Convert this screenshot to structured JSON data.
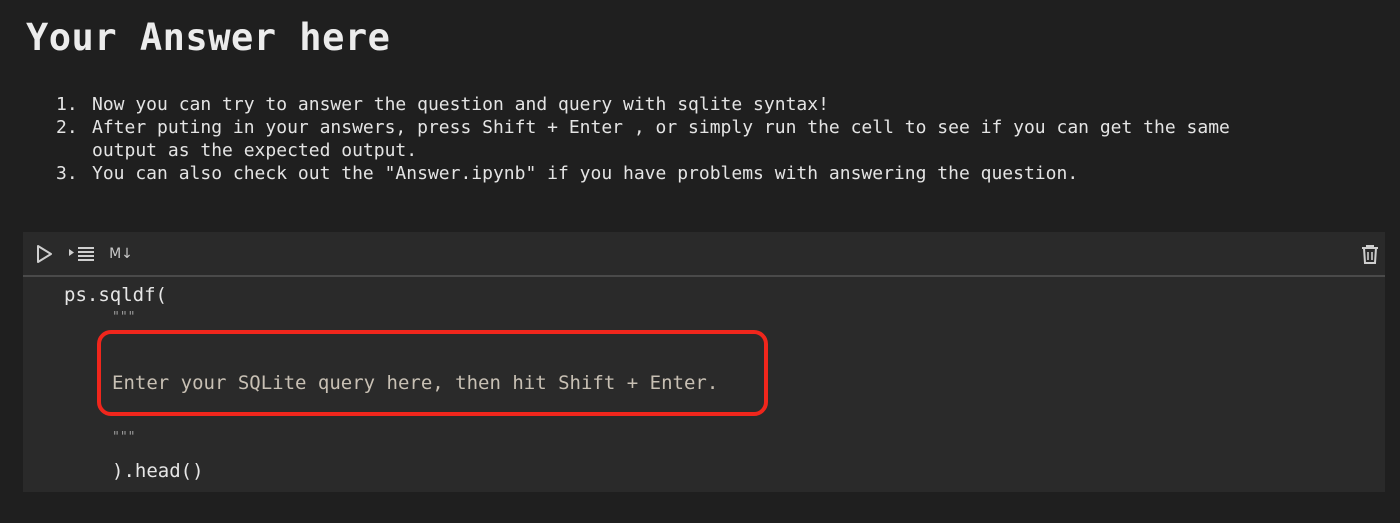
{
  "heading": {
    "title": "Your Answer here"
  },
  "instructions": [
    {
      "num": "1.",
      "lines": [
        "Now you can try to answer the question and query with sqlite syntax!"
      ]
    },
    {
      "num": "2.",
      "lines": [
        "After puting in your answers, press Shift + Enter , or simply run the cell to see if you can get the same",
        "output as the expected output."
      ]
    },
    {
      "num": "3.",
      "lines": [
        "You can also check out the \"Answer.ipynb\" if you have problems with answering the question."
      ]
    }
  ],
  "cell_toolbar": {
    "run_icon": "play-icon",
    "run_below_icon": "run-below-icon",
    "markdown_label": "M↓",
    "delete_icon": "trash-icon"
  },
  "code": {
    "line1": "ps.sqldf(",
    "open_quotes": "\"\"\"",
    "placeholder": "Enter your SQLite query here, then hit Shift + Enter.",
    "close_quotes": "\"\"\"",
    "last_line": ").head()"
  },
  "colors": {
    "background": "#1f1f1f",
    "cell_background": "#2a2a2a",
    "highlight_border": "#f0261c"
  }
}
